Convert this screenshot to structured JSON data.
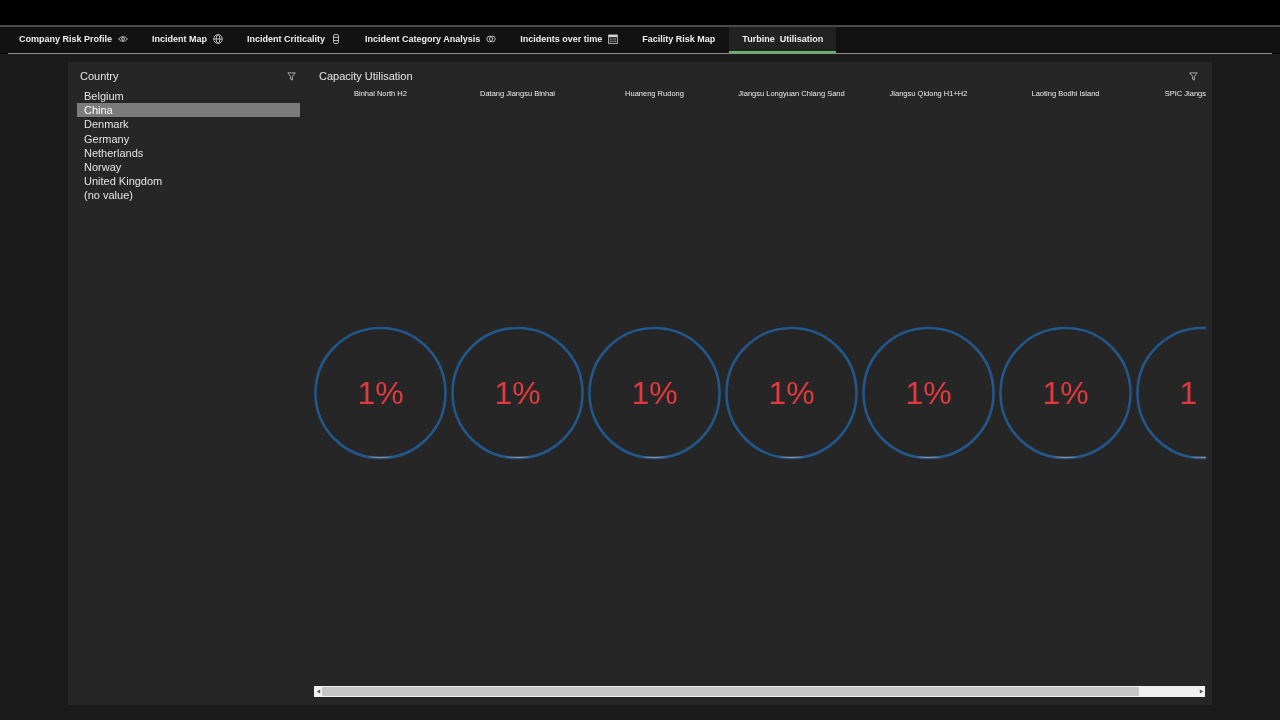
{
  "tabs": [
    {
      "label": "Company Risk Profile",
      "selected": false
    },
    {
      "label": "Incident Map",
      "selected": false
    },
    {
      "label": "Incident Criticality",
      "selected": false
    },
    {
      "label": "Incident Category Analysis",
      "selected": false
    },
    {
      "label": "Incidents over time",
      "selected": false
    },
    {
      "label": "Facility Risk Map",
      "selected": false
    },
    {
      "label": "Turbine  Utilisation",
      "selected": true
    }
  ],
  "country_filter": {
    "title": "Country",
    "items": [
      {
        "label": "Belgium",
        "selected": false
      },
      {
        "label": "China",
        "selected": true
      },
      {
        "label": "Denmark",
        "selected": false
      },
      {
        "label": "Germany",
        "selected": false
      },
      {
        "label": "Netherlands",
        "selected": false
      },
      {
        "label": "Norway",
        "selected": false
      },
      {
        "label": "United Kingdom",
        "selected": false
      },
      {
        "label": "(no value)",
        "selected": false
      }
    ]
  },
  "capacity_utilisation": {
    "title": "Capacity Utilisation",
    "gauges": [
      {
        "name": "Binhai North H2",
        "value": "1%",
        "level": 0.01
      },
      {
        "name": "Datang Jiangsu Binhai",
        "value": "1%",
        "level": 0.01
      },
      {
        "name": "Huaneng Rudong",
        "value": "1%",
        "level": 0.01
      },
      {
        "name": "Jiangsu Longyuan Chiang Sand",
        "value": "1%",
        "level": 0.01
      },
      {
        "name": "Jiangsu Qidong H1+H2",
        "value": "1%",
        "level": 0.01
      },
      {
        "name": "Laoting Bodhi Island",
        "value": "1%",
        "level": 0.01
      },
      {
        "name": "SPIC Jiangs",
        "value": "1",
        "level": 0.01
      }
    ]
  }
}
